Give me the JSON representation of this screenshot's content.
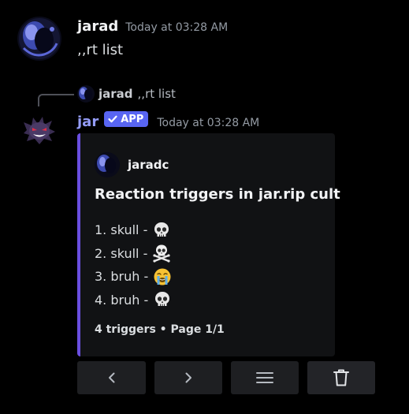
{
  "message": {
    "author": "jarad",
    "timestamp": "Today at 03:28 AM",
    "text": ",,rt list"
  },
  "reply": {
    "author": "jarad",
    "text": ",,rt list"
  },
  "bot_message": {
    "author": "jar",
    "badge": "APP",
    "timestamp": "Today at 03:28 AM"
  },
  "embed": {
    "author": "jaradc",
    "title": "Reaction triggers in jar.rip cult",
    "items": [
      {
        "text": "1. skull -",
        "emoji": "skull-emoji"
      },
      {
        "text": "2. skull -",
        "emoji": "skull-and-crossbones-emoji"
      },
      {
        "text": "3. bruh -",
        "emoji": "loudly-crying-face-emoji"
      },
      {
        "text": "4. bruh -",
        "emoji": "skull-emoji"
      }
    ],
    "footer": "4 triggers • Page 1/1",
    "accent_color": "#6a4fe0"
  },
  "buttons": [
    {
      "icon": "chevron-left-icon"
    },
    {
      "icon": "chevron-right-icon"
    },
    {
      "icon": "hamburger-menu-icon"
    },
    {
      "icon": "trash-icon"
    }
  ],
  "colors": {
    "background": "#000000",
    "bot_name": "#949cf7",
    "badge": "#5865f2"
  }
}
